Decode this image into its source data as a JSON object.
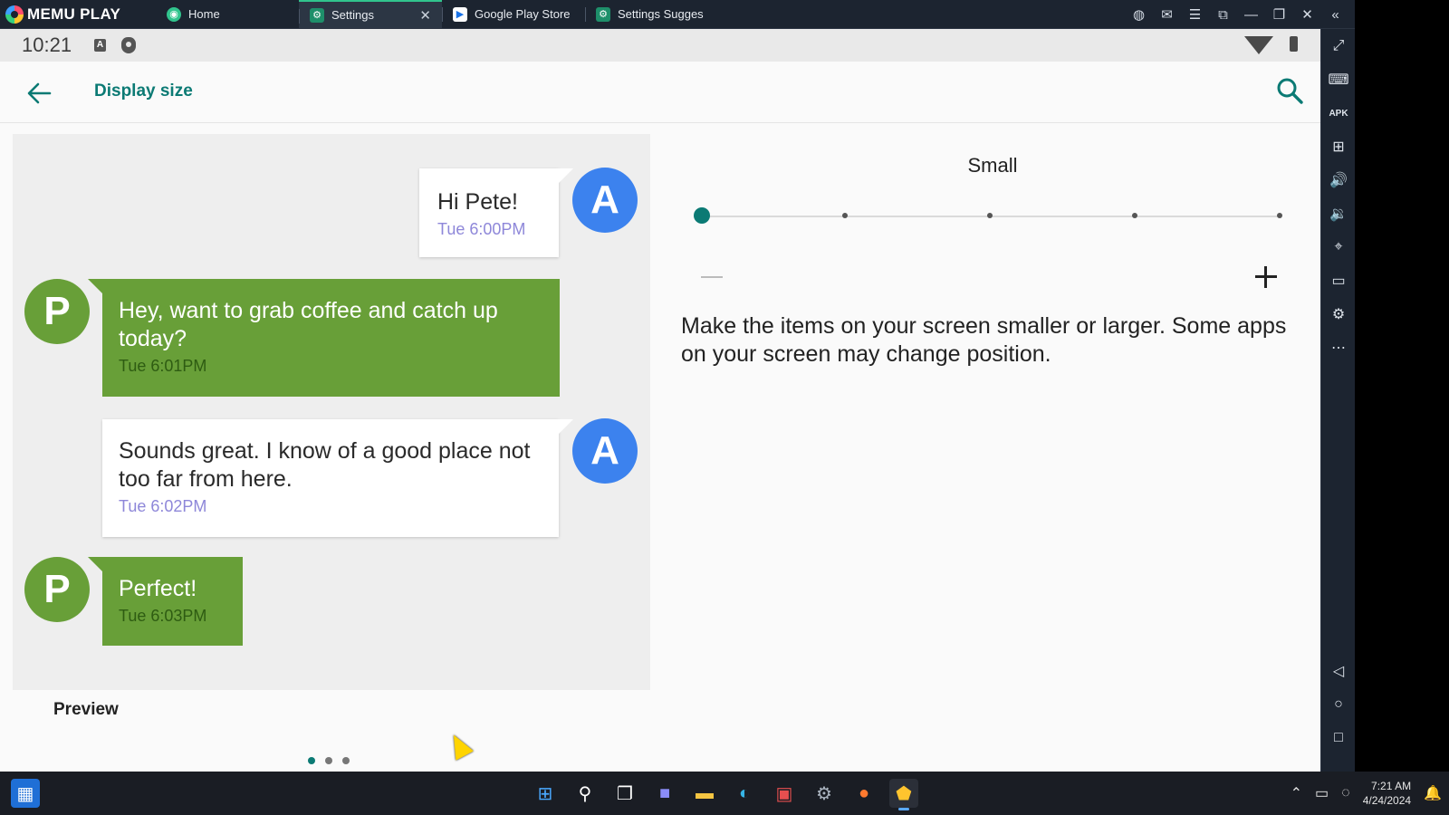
{
  "emulator": {
    "brand": "MEMU PLAY",
    "tabs": [
      {
        "label": "Home",
        "icon": "home-icon",
        "color": "#31c48d"
      },
      {
        "label": "Settings",
        "icon": "gear-icon",
        "color": "#31c48d",
        "active": true
      },
      {
        "label": "Google Play Store",
        "icon": "play-store-icon",
        "color": "#ffffff"
      },
      {
        "label": "Settings Sugges",
        "icon": "gear-icon",
        "color": "#31c48d"
      }
    ],
    "window_controls": [
      "account-icon",
      "mail-icon",
      "menu-icon",
      "screen-mirror-icon",
      "minimize-icon",
      "restore-icon",
      "close-icon",
      "collapse-sidebar-icon"
    ],
    "sidebar_tools": [
      "fullscreen-icon",
      "keyboard-icon",
      "apk-icon",
      "add-window-icon",
      "volume-up-icon",
      "volume-down-icon",
      "location-icon",
      "folder-icon",
      "settings-icon",
      "more-icon",
      "android-back-icon",
      "android-home-icon",
      "android-recents-icon"
    ]
  },
  "android": {
    "status": {
      "time": "10:21"
    },
    "appbar": {
      "title": "Display size"
    },
    "preview": {
      "label": "Preview",
      "messages": [
        {
          "sender": "A",
          "text": "Hi Pete!",
          "time": "Tue 6:00PM"
        },
        {
          "sender": "P",
          "text": "Hey, want to grab coffee and catch up today?",
          "time": "Tue 6:01PM"
        },
        {
          "sender": "A",
          "text": "Sounds great. I know of a good place not too far from here.",
          "time": "Tue 6:02PM"
        },
        {
          "sender": "P",
          "text": "Perfect!",
          "time": "Tue 6:03PM"
        }
      ],
      "page_indicator": {
        "count": 3,
        "active": 0
      }
    },
    "size_setting": {
      "current_label": "Small",
      "steps": 5,
      "current_step": 0,
      "description": "Make the items on your screen smaller or larger. Some apps on your screen may change position."
    }
  },
  "taskbar": {
    "apps": [
      "start-icon",
      "search-icon",
      "task-view-icon",
      "chat-icon",
      "file-explorer-icon",
      "edge-icon",
      "store-icon",
      "settings-icon",
      "firefox-icon",
      "memu-icon"
    ],
    "time": "7:21 AM",
    "date": "4/24/2024"
  },
  "colors": {
    "accent": "#0b7a74",
    "avatar_a": "#3c82ee",
    "avatar_p": "#689f38",
    "timestamp": "#8e87d9"
  }
}
